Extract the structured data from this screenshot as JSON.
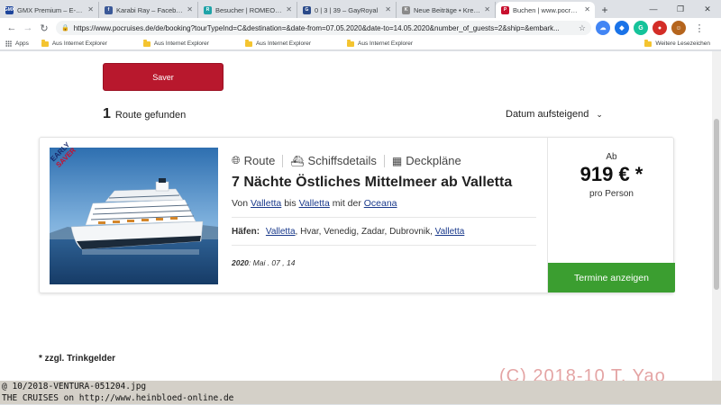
{
  "tabs": [
    {
      "title": "GMX Premium – E-Mail",
      "favicon": "GMX",
      "color": "#1c449b",
      "active": false
    },
    {
      "title": "Karabi Ray – Facebook",
      "favicon": "f",
      "color": "#3b5998",
      "active": false
    },
    {
      "title": "Besucher | ROMEO | Gay",
      "favicon": "R",
      "color": "#1fa3a8",
      "active": false
    },
    {
      "title": "0 | 3 | 39 – GayRoyal",
      "favicon": "G",
      "color": "#2a4a8a",
      "active": false
    },
    {
      "title": "Neue Beiträge • Kreuzf",
      "favicon": "K",
      "color": "#8a8a8a",
      "active": false
    },
    {
      "title": "Buchen | www.pocruises",
      "favicon": "P",
      "color": "#c8102e",
      "active": true
    }
  ],
  "window_controls": {
    "minimize": "—",
    "maximize": "❐",
    "close": "✕"
  },
  "toolbar": {
    "url": "https://www.pocruises.de/de/booking?tourTypeInd=C&destination=&date-from=07.05.2020&date-to=14.05.2020&number_of_guests=2&ship=&embark...",
    "extensions": [
      {
        "name": "cloud-extension-icon",
        "glyph": "☁",
        "color": "#4285f4"
      },
      {
        "name": "shield-extension-icon",
        "glyph": "◆",
        "color": "#1a73e8"
      },
      {
        "name": "grammarly-extension-icon",
        "glyph": "G",
        "color": "#15c39a"
      },
      {
        "name": "lastpass-extension-icon",
        "glyph": "●",
        "color": "#d32d27"
      },
      {
        "name": "profile-avatar-icon",
        "glyph": "☺",
        "color": "#b5651d"
      }
    ]
  },
  "bookmarks": {
    "apps": "Apps",
    "items": [
      "Aus Internet Explorer",
      "Aus Internet Explorer",
      "Aus Internet Explorer",
      "Aus Internet Explorer"
    ],
    "other": "Weitere Lesezeichen"
  },
  "page": {
    "saver_button": "Saver",
    "result_count": "1",
    "result_label": "Route gefunden",
    "sort_label": "Datum aufsteigend",
    "card": {
      "badge_line1": "EARLY",
      "badge_line2": "SAVER",
      "tabs": [
        "Route",
        "Schiffsdetails",
        "Deckpläne"
      ],
      "title": "7 Nächte Östliches Mittelmeer ab Valletta",
      "route": {
        "from_prefix": "Von",
        "from": "Valletta",
        "to_prefix": "bis",
        "to": "Valletta",
        "ship_prefix": "mit der",
        "ship": "Oceana"
      },
      "ports_label": "Häfen:",
      "ports": [
        {
          "name": "Valletta",
          "link": true
        },
        {
          "name": "Hvar",
          "link": false
        },
        {
          "name": "Venedig",
          "link": false
        },
        {
          "name": "Zadar",
          "link": false
        },
        {
          "name": "Dubrovnik",
          "link": false
        },
        {
          "name": "Valletta",
          "link": true
        }
      ],
      "dates_year": "2020",
      "dates_text": ": Mai . 07 , 14",
      "price_prefix": "Ab",
      "price": "919 € *",
      "price_unit": "pro Person",
      "cta": "Termine anzeigen"
    },
    "footnote": "* zzgl. Trinkgelder"
  },
  "overlay": {
    "watermark": "(C) 2018-10 T. Yao",
    "line1": "@ 10/2018-VENTURA-051204.jpg",
    "line2": "THE CRUISES on http://www.heinbloed-online.de"
  }
}
